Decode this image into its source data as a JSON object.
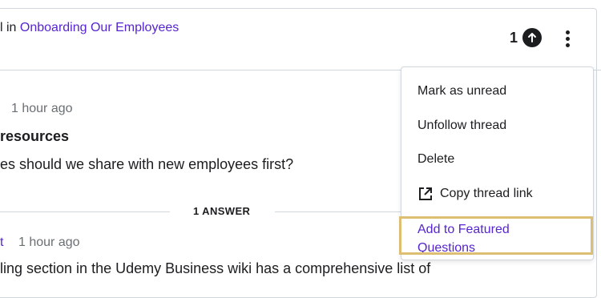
{
  "header": {
    "prefix": "l in",
    "course_link": "Onboarding Our Employees",
    "upvote_count": "1"
  },
  "question": {
    "time": "1 hour ago",
    "title": "resources",
    "body": "es should we share with new employees first?"
  },
  "answers": {
    "count_label": "1 ANSWER"
  },
  "answer": {
    "author_fragment": "t",
    "time": "1 hour ago",
    "body": "ling section in the Udemy Business wiki has a comprehensive list of"
  },
  "menu": {
    "items": [
      {
        "label": "Mark as unread"
      },
      {
        "label": "Unfollow thread"
      },
      {
        "label": "Delete"
      },
      {
        "label": "Copy thread link",
        "icon": "external-link-icon"
      },
      {
        "label": "Add to Featured Questions"
      }
    ]
  },
  "colors": {
    "accent": "#5624d0",
    "text": "#1c1d1f",
    "muted": "#6a6f73",
    "border": "#d1d7dc",
    "highlight": "#dcbf73"
  }
}
